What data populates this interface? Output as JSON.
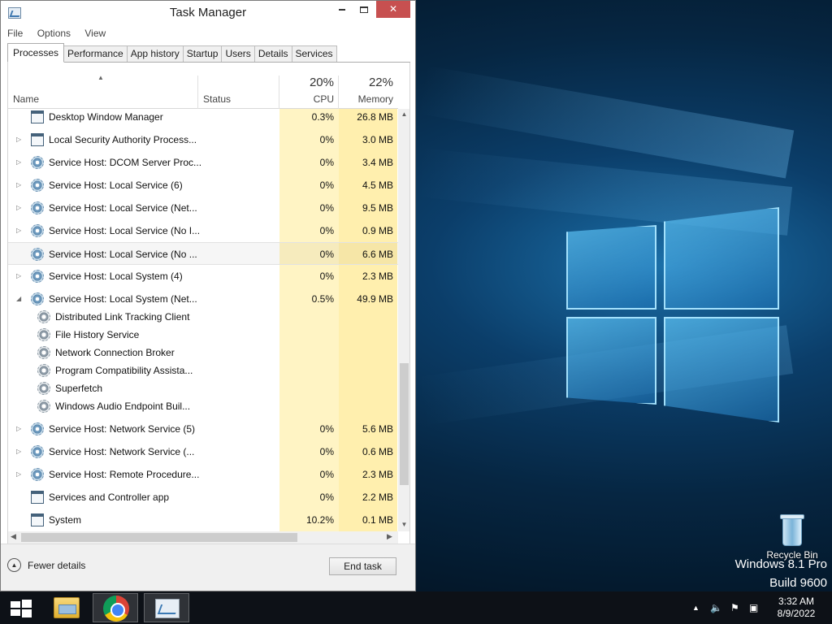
{
  "window": {
    "title": "Task Manager",
    "controls": {
      "minimize": "",
      "maximize": "",
      "close": "✕"
    }
  },
  "menu": [
    "File",
    "Options",
    "View"
  ],
  "tabs": [
    "Processes",
    "Performance",
    "App history",
    "Startup",
    "Users",
    "Details",
    "Services"
  ],
  "active_tab": "Processes",
  "columns": {
    "name": "Name",
    "status": "Status",
    "cpu_pct": "20%",
    "cpu": "CPU",
    "memory_pct": "22%",
    "memory": "Memory"
  },
  "processes": [
    {
      "name": "Desktop Window Manager",
      "cpu": "0.3%",
      "mem": "26.8 MB",
      "icon": "window-icon",
      "expander": ""
    },
    {
      "name": "Local Security Authority Process...",
      "cpu": "0%",
      "mem": "3.0 MB",
      "icon": "window-icon",
      "expander": "▷"
    },
    {
      "name": "Service Host: DCOM Server Proc...",
      "cpu": "0%",
      "mem": "3.4 MB",
      "icon": "gear-icon",
      "expander": "▷"
    },
    {
      "name": "Service Host: Local Service (6)",
      "cpu": "0%",
      "mem": "4.5 MB",
      "icon": "gear-icon",
      "expander": "▷"
    },
    {
      "name": "Service Host: Local Service (Net...",
      "cpu": "0%",
      "mem": "9.5 MB",
      "icon": "gear-icon",
      "expander": "▷"
    },
    {
      "name": "Service Host: Local Service (No I...",
      "cpu": "0%",
      "mem": "0.9 MB",
      "icon": "gear-icon",
      "expander": "▷"
    },
    {
      "name": "Service Host: Local Service (No ...",
      "cpu": "0%",
      "mem": "6.6 MB",
      "icon": "gear-icon",
      "expander": "",
      "selected": true
    },
    {
      "name": "Service Host: Local System (4)",
      "cpu": "0%",
      "mem": "2.3 MB",
      "icon": "gear-icon",
      "expander": "▷"
    },
    {
      "name": "Service Host: Local System (Net...",
      "cpu": "0.5%",
      "mem": "49.9 MB",
      "icon": "gear-icon",
      "expander": "◢"
    }
  ],
  "subservices": [
    "Distributed Link Tracking Client",
    "File History Service",
    "Network Connection Broker",
    "Program Compatibility Assista...",
    "Superfetch",
    "Windows Audio Endpoint Buil..."
  ],
  "processes_after": [
    {
      "name": "Service Host: Network Service (5)",
      "cpu": "0%",
      "mem": "5.6 MB",
      "icon": "gear-icon",
      "expander": "▷"
    },
    {
      "name": "Service Host: Network Service (...",
      "cpu": "0%",
      "mem": "0.6 MB",
      "icon": "gear-icon",
      "expander": "▷"
    },
    {
      "name": "Service Host: Remote Procedure...",
      "cpu": "0%",
      "mem": "2.3 MB",
      "icon": "gear-icon",
      "expander": "▷"
    },
    {
      "name": "Services and Controller app",
      "cpu": "0%",
      "mem": "2.2 MB",
      "icon": "window-icon",
      "expander": ""
    },
    {
      "name": "System",
      "cpu": "10.2%",
      "mem": "0.1 MB",
      "icon": "window-icon",
      "expander": ""
    }
  ],
  "footer": {
    "fewer_details": "Fewer details",
    "end_task": "End task"
  },
  "desktop": {
    "recycle_bin": "Recycle Bin",
    "watermark_line1": "Windows 8.1 Pro",
    "watermark_line2": "Build 9600"
  },
  "taskbar": {
    "apps": [
      "File Explorer",
      "Google Chrome",
      "Task Manager"
    ],
    "time": "3:32 AM",
    "date": "8/9/2022",
    "tray_chevron": "▲"
  },
  "colors": {
    "cpu_heat": "#fff4c4",
    "mem_heat": "#ffefae",
    "close_button": "#c75050",
    "taskbar": "#0d1117"
  }
}
